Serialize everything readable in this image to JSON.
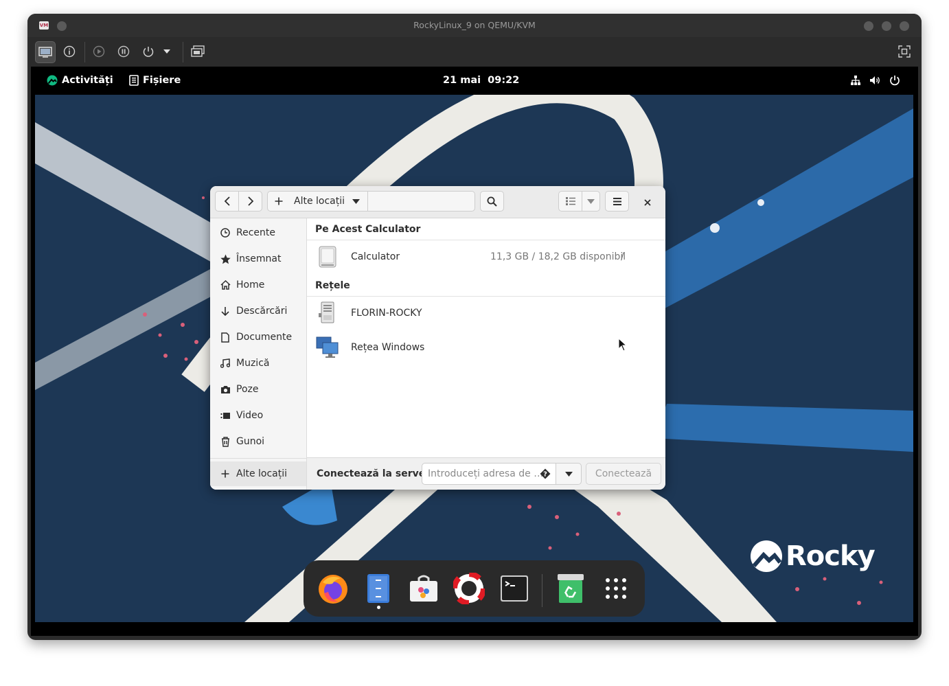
{
  "vm": {
    "title": "RockyLinux_9 on QEMU/KVM"
  },
  "gnome": {
    "activities": "Activități",
    "app_menu": "Fișiere",
    "clock": "21 mai  09:22"
  },
  "nautilus": {
    "location": "Alte locații",
    "sidebar": [
      {
        "label": "Recente",
        "icon": "clock-icon"
      },
      {
        "label": "Însemnat",
        "icon": "star-icon"
      },
      {
        "label": "Home",
        "icon": "home-icon"
      },
      {
        "label": "Descărcări",
        "icon": "download-icon"
      },
      {
        "label": "Documente",
        "icon": "document-icon"
      },
      {
        "label": "Muzică",
        "icon": "music-icon"
      },
      {
        "label": "Poze",
        "icon": "camera-icon"
      },
      {
        "label": "Video",
        "icon": "video-icon"
      },
      {
        "label": "Gunoi",
        "icon": "trash-icon"
      }
    ],
    "other_locations": "Alte locații",
    "section_computer": "Pe Acest Calculator",
    "computer": {
      "name": "Calculator",
      "size": "11,3 GB / 18,2 GB disponibil",
      "mount": "/"
    },
    "section_networks": "Rețele",
    "networks": [
      {
        "name": "FLORIN-ROCKY",
        "icon": "server-icon"
      },
      {
        "name": "Rețea Windows",
        "icon": "windows-network-icon"
      }
    ],
    "connect_label": "Conectează la server",
    "address_placeholder": "Introduceți adresa de …",
    "connect_button": "Conectează"
  },
  "desktop": {
    "brand": "Rocky"
  },
  "dock": [
    "firefox-icon",
    "files-icon",
    "software-icon",
    "help-icon",
    "terminal-icon",
    "recycle-icon",
    "app-grid-icon"
  ]
}
